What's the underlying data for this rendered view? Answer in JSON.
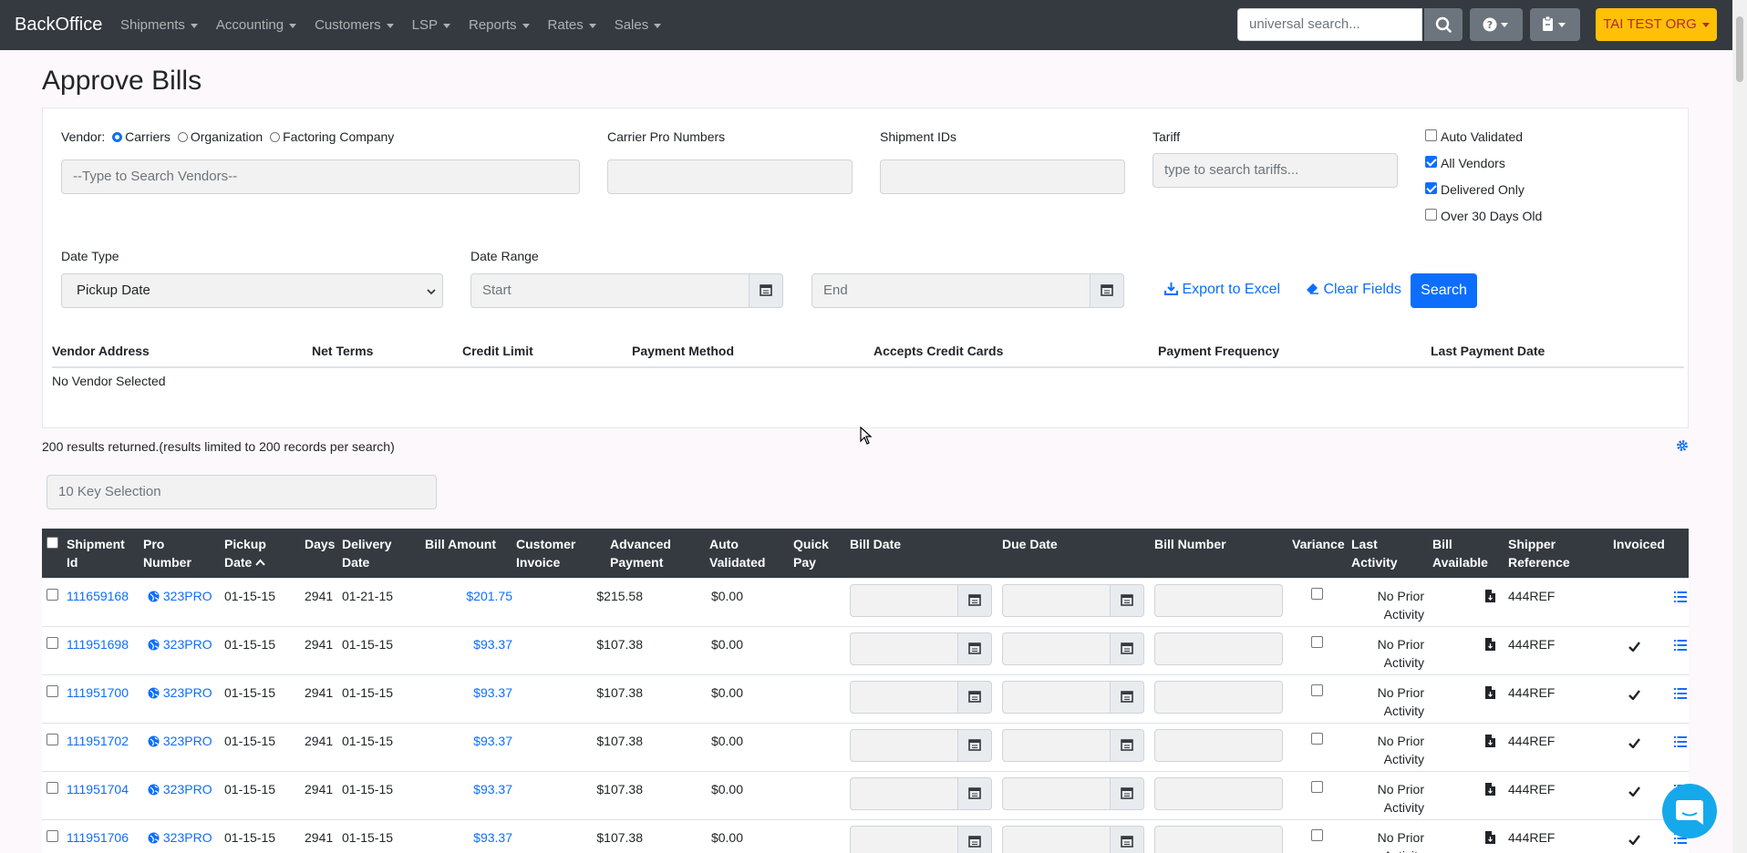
{
  "nav": {
    "brand": "BackOffice",
    "items": [
      "Shipments",
      "Accounting",
      "Customers",
      "LSP",
      "Reports",
      "Rates",
      "Sales"
    ],
    "search_placeholder": "universal search...",
    "org_label": "TAI TEST ORG"
  },
  "page": {
    "title": "Approve Bills"
  },
  "filters": {
    "vendor_label": "Vendor:",
    "vendor_options": [
      "Carriers",
      "Organization",
      "Factoring Company"
    ],
    "vendor_selected": "Carriers",
    "vendor_search_placeholder": "--Type to Search Vendors--",
    "carrier_pro_label": "Carrier Pro Numbers",
    "shipment_ids_label": "Shipment IDs",
    "tariff_label": "Tariff",
    "tariff_placeholder": "type to search tariffs...",
    "checkboxes": [
      {
        "label": "Auto Validated",
        "checked": false
      },
      {
        "label": "All Vendors",
        "checked": true
      },
      {
        "label": "Delivered Only",
        "checked": true
      },
      {
        "label": "Over 30 Days Old",
        "checked": false
      }
    ],
    "date_type_label": "Date Type",
    "date_type_value": "Pickup Date",
    "date_range_label": "Date Range",
    "start_placeholder": "Start",
    "end_placeholder": "End",
    "export_label": "Export to Excel",
    "clear_label": "Clear Fields",
    "search_label": "Search"
  },
  "vendor_info": {
    "headers": [
      "Vendor Address",
      "Net Terms",
      "Credit Limit",
      "Payment Method",
      "Accepts Credit Cards",
      "Payment Frequency",
      "Last Payment Date"
    ],
    "empty_text": "No Vendor Selected"
  },
  "results": {
    "summary": "200 results returned.(results limited to 200 records per search)",
    "tenkey_placeholder": "10 Key Selection"
  },
  "grid": {
    "headers": {
      "shipment_id": [
        "Shipment",
        "Id"
      ],
      "pro_number": [
        "Pro",
        "Number"
      ],
      "pickup_date": [
        "Pickup",
        "Date"
      ],
      "days": [
        "Days"
      ],
      "delivery_date": [
        "Delivery",
        "Date"
      ],
      "bill_amount": [
        "Bill Amount"
      ],
      "customer_invoice": [
        "Customer",
        "Invoice"
      ],
      "advanced_payment": [
        "Advanced",
        "Payment"
      ],
      "auto_validated": [
        "Auto",
        "Validated"
      ],
      "quick_pay": [
        "Quick",
        "Pay"
      ],
      "bill_date": [
        "Bill Date"
      ],
      "due_date": [
        "Due Date"
      ],
      "bill_number": [
        "Bill Number"
      ],
      "variance": [
        "Variance"
      ],
      "last_activity": [
        "Last",
        "Activity"
      ],
      "bill_available": [
        "Bill",
        "Available"
      ],
      "shipper_reference": [
        "Shipper",
        "Reference"
      ],
      "invoiced": [
        "Invoiced"
      ]
    },
    "rows": [
      {
        "shipment_id": "111659168",
        "pro": "323PRO",
        "pickup": "01-15-15",
        "days": "2941",
        "delivery": "01-21-15",
        "bill": "$201.75",
        "invoice": "$215.58",
        "advanced": "$0.00",
        "activity": [
          "No Prior",
          "Activity"
        ],
        "shipper_ref": "444REF",
        "invoiced": false
      },
      {
        "shipment_id": "111951698",
        "pro": "323PRO",
        "pickup": "01-15-15",
        "days": "2941",
        "delivery": "01-15-15",
        "bill": "$93.37",
        "invoice": "$107.38",
        "advanced": "$0.00",
        "activity": [
          "No Prior",
          "Activity"
        ],
        "shipper_ref": "444REF",
        "invoiced": true
      },
      {
        "shipment_id": "111951700",
        "pro": "323PRO",
        "pickup": "01-15-15",
        "days": "2941",
        "delivery": "01-15-15",
        "bill": "$93.37",
        "invoice": "$107.38",
        "advanced": "$0.00",
        "activity": [
          "No Prior",
          "Activity"
        ],
        "shipper_ref": "444REF",
        "invoiced": true
      },
      {
        "shipment_id": "111951702",
        "pro": "323PRO",
        "pickup": "01-15-15",
        "days": "2941",
        "delivery": "01-15-15",
        "bill": "$93.37",
        "invoice": "$107.38",
        "advanced": "$0.00",
        "activity": [
          "No Prior",
          "Activity"
        ],
        "shipper_ref": "444REF",
        "invoiced": true
      },
      {
        "shipment_id": "111951704",
        "pro": "323PRO",
        "pickup": "01-15-15",
        "days": "2941",
        "delivery": "01-15-15",
        "bill": "$93.37",
        "invoice": "$107.38",
        "advanced": "$0.00",
        "activity": [
          "No Prior",
          "Activity"
        ],
        "shipper_ref": "444REF",
        "invoiced": true
      },
      {
        "shipment_id": "111951706",
        "pro": "323PRO",
        "pickup": "01-15-15",
        "days": "2941",
        "delivery": "01-15-15",
        "bill": "$93.37",
        "invoice": "$107.38",
        "advanced": "$0.00",
        "activity": [
          "No Prior",
          "Activity"
        ],
        "shipper_ref": "444REF",
        "invoiced": true
      }
    ]
  },
  "colors": {
    "navbar": "#343a40",
    "accent": "#0d6efd",
    "org_button": "#ffc107",
    "chat": "#15a9ec"
  }
}
